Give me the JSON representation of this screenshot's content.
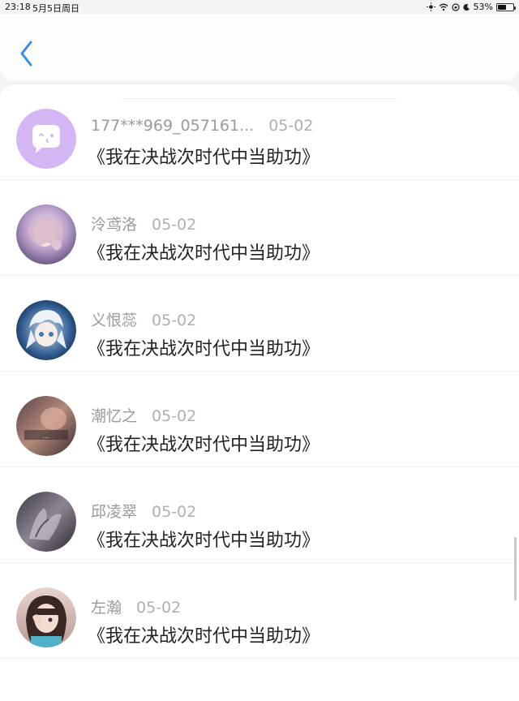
{
  "status": {
    "time": "23:18",
    "date": "5月5日周日",
    "battery": "53%",
    "battery_level": 0.53
  },
  "header": {
    "back_icon": "chevron-left-icon"
  },
  "list": [
    {
      "name": "177***969_057161...",
      "date": "05-02",
      "title": "《我在决战次时代中当助功》",
      "avatar": "chat-bubble-avatar",
      "avatar_color": "#d4b6f4"
    },
    {
      "name": "泠鸢洛",
      "date": "05-02",
      "title": "《我在决战次时代中当助功》",
      "avatar": "anime-girl-avatar",
      "avatar_color": "#b9a2c7"
    },
    {
      "name": "义恨蕊",
      "date": "05-02",
      "title": "《我在决战次时代中当助功》",
      "avatar": "anime-boy-avatar",
      "avatar_color": "#3a5f8e"
    },
    {
      "name": "潮忆之",
      "date": "05-02",
      "title": "《我在决战次时代中当助功》",
      "avatar": "photo-avatar",
      "avatar_color": "#8b5e5e"
    },
    {
      "name": "邱凌翠",
      "date": "05-02",
      "title": "《我在决战次时代中当助功》",
      "avatar": "hands-avatar",
      "avatar_color": "#6b6470"
    },
    {
      "name": "左瀚",
      "date": "05-02",
      "title": "《我在决战次时代中当助功》",
      "avatar": "girl-photo-avatar",
      "avatar_color": "#c48b7a"
    }
  ]
}
